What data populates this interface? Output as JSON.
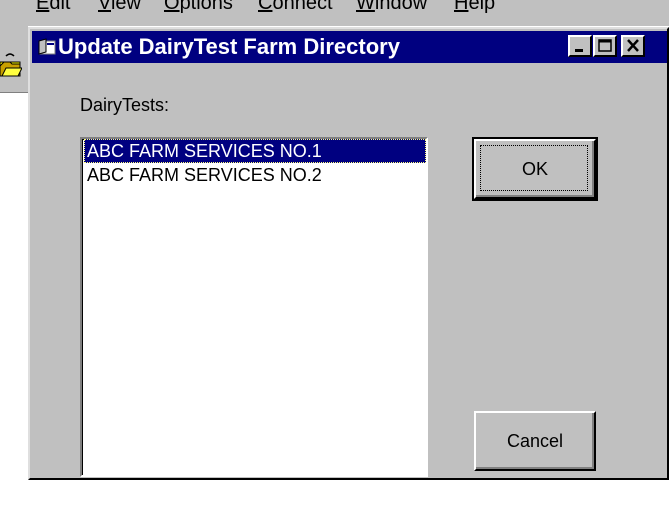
{
  "parent_menu": {
    "items": [
      {
        "label": "Edit",
        "mnemonic": "E",
        "rest": "dit"
      },
      {
        "label": "View",
        "mnemonic": "V",
        "rest": "iew"
      },
      {
        "label": "Options",
        "mnemonic": "O",
        "rest": "ptions"
      },
      {
        "label": "Connect",
        "mnemonic": "C",
        "rest": "onnect"
      },
      {
        "label": "Window",
        "mnemonic": "W",
        "rest": "indow"
      },
      {
        "label": "Help",
        "mnemonic": "H",
        "rest": "elp"
      }
    ]
  },
  "dialog": {
    "title": "Update DairyTest Farm Directory",
    "list_label": "DairyTests:",
    "list_items": [
      {
        "text": "ABC FARM SERVICES NO.1",
        "selected": true
      },
      {
        "text": "ABC FARM SERVICES NO.2",
        "selected": false
      }
    ],
    "ok_label": "OK",
    "cancel_label": "Cancel"
  },
  "colors": {
    "titlebar": "#000080",
    "selection": "#000080",
    "face": "#c0c0c0"
  },
  "icons": {
    "title_icon": "window-app-icon",
    "toolbar_icon": "open-folder-icon",
    "minimize": "minimize-icon",
    "maximize": "maximize-icon",
    "close": "close-icon"
  }
}
